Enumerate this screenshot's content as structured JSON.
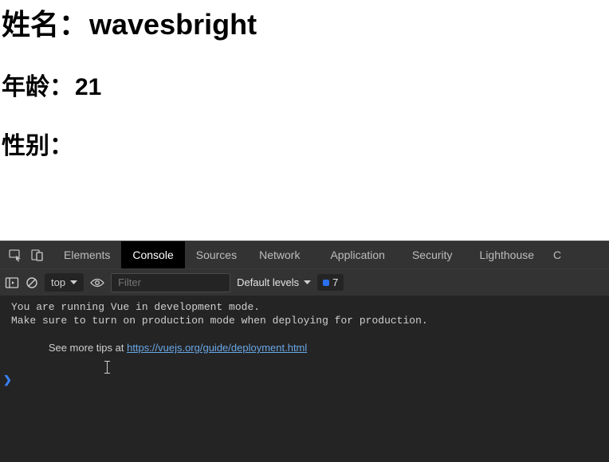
{
  "page": {
    "name_label": "姓名：",
    "name_value": "wavesbright",
    "age_label": "年龄：",
    "age_value": "21",
    "gender_label": "性别：",
    "gender_value": ""
  },
  "devtools": {
    "tabs": {
      "elements": "Elements",
      "console": "Console",
      "sources": "Sources",
      "network": "Network",
      "application": "Application",
      "security": "Security",
      "lighthouse": "Lighthouse",
      "overflow": "C"
    },
    "toolbar": {
      "context": "top",
      "filter_placeholder": "Filter",
      "levels_label": "Default levels",
      "issue_count": "7"
    },
    "console": {
      "msg_line1": "You are running Vue in development mode.",
      "msg_line2": "Make sure to turn on production mode when deploying for production.",
      "msg_line3_prefix": "See more tips at ",
      "msg_line3_link": "https://vuejs.org/guide/deployment.html"
    }
  }
}
